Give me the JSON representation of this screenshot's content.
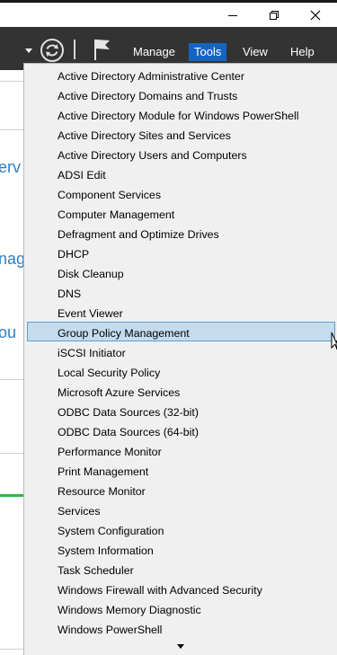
{
  "window": {
    "controls": [
      "minimize",
      "restore",
      "close"
    ]
  },
  "toolbar": {
    "menu": [
      {
        "label": "Manage",
        "active": false
      },
      {
        "label": "Tools",
        "active": true
      },
      {
        "label": "View",
        "active": false
      },
      {
        "label": "Help",
        "active": false
      }
    ],
    "icons": [
      "dropdown-arrow-icon",
      "refresh-icon",
      "flag-icon"
    ]
  },
  "background_window": {
    "partial_texts": [
      "erv",
      "nag",
      "ou"
    ]
  },
  "tools_menu": {
    "highlighted_index": 13,
    "items": [
      "Active Directory Administrative Center",
      "Active Directory Domains and Trusts",
      "Active Directory Module for Windows PowerShell",
      "Active Directory Sites and Services",
      "Active Directory Users and Computers",
      "ADSI Edit",
      "Component Services",
      "Computer Management",
      "Defragment and Optimize Drives",
      "DHCP",
      "Disk Cleanup",
      "DNS",
      "Event Viewer",
      "Group Policy Management",
      "iSCSI Initiator",
      "Local Security Policy",
      "Microsoft Azure Services",
      "ODBC Data Sources (32-bit)",
      "ODBC Data Sources (64-bit)",
      "Performance Monitor",
      "Print Management",
      "Resource Monitor",
      "Services",
      "System Configuration",
      "System Information",
      "Task Scheduler",
      "Windows Firewall with Advanced Security",
      "Windows Memory Diagnostic",
      "Windows PowerShell"
    ],
    "scroll_down_icon": "chevron-down-icon"
  },
  "colors": {
    "toolbar_bg": "#333333",
    "active_menu": "#1565c0",
    "highlight_bg": "#c4dcee",
    "highlight_border": "#5aa0d8",
    "menu_bg": "#f0f0f0",
    "link_blue": "#2f7fc1",
    "status_green": "#2db83d"
  }
}
